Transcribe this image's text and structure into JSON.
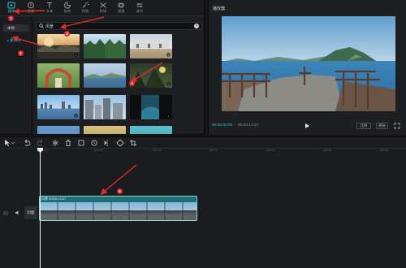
{
  "toolbar": {
    "items": [
      {
        "label": "媒体",
        "icon": "media-icon",
        "active": true
      },
      {
        "label": "音频",
        "icon": "audio-icon"
      },
      {
        "label": "文本",
        "icon": "text-icon"
      },
      {
        "label": "贴纸",
        "icon": "sticker-icon"
      },
      {
        "label": "特效",
        "icon": "effects-icon"
      },
      {
        "label": "转场",
        "icon": "transition-icon"
      },
      {
        "label": "滤镜",
        "icon": "filter-icon"
      },
      {
        "label": "调节",
        "icon": "adjust-icon"
      }
    ]
  },
  "sidebar": {
    "items": [
      {
        "label": "本地"
      },
      {
        "label": "素材库"
      }
    ]
  },
  "search": {
    "value": "风景"
  },
  "player": {
    "title": "播放器",
    "time_current": "00:00:00:00",
    "time_total": "00:00:13:27",
    "ratio_label": "比例",
    "original_label": "原始"
  },
  "timeline": {
    "ticks": [
      "00:00",
      "|00:05",
      "|00:10",
      "|00:15",
      "|00:20",
      "|00:25",
      "|00:30"
    ],
    "track_cover_label": "封面",
    "clip_label": "风景 00:00:13:27"
  },
  "annotations": [
    "1",
    "2",
    "3",
    "4",
    "5"
  ],
  "colors": {
    "accent": "#25c7d6",
    "arrow": "#e22b2b",
    "clip": "#1d6f74"
  }
}
